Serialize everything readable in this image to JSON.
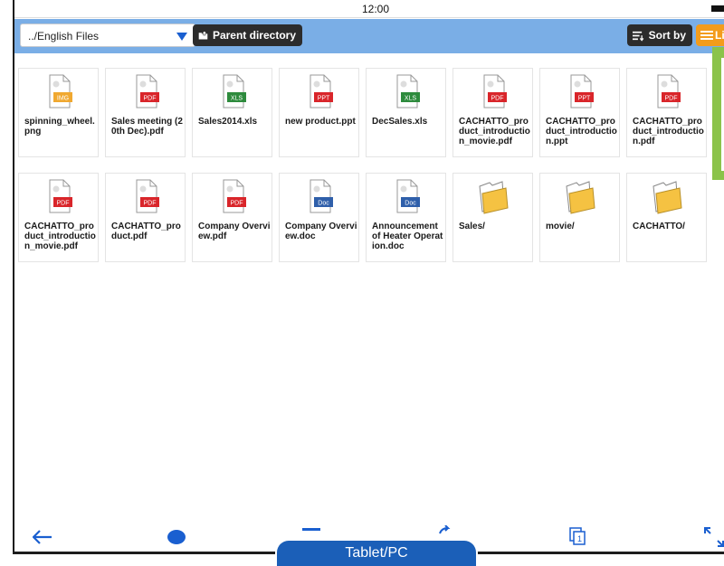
{
  "status_bar": {
    "time": "12:00"
  },
  "toolbar": {
    "path_value": "../English Files",
    "parent_label": "Parent directory",
    "sort_label": "Sort by",
    "list_label": "Li"
  },
  "files": [
    {
      "name": "spinning_wheel.png",
      "type": "IMG",
      "color": "#f0a830"
    },
    {
      "name": "Sales meeting (20th Dec).pdf",
      "type": "PDF",
      "color": "#d9252a"
    },
    {
      "name": "Sales2014.xls",
      "type": "XLS",
      "color": "#2e8b3d"
    },
    {
      "name": "new product.ppt",
      "type": "PPT",
      "color": "#d9252a"
    },
    {
      "name": "DecSales.xls",
      "type": "XLS",
      "color": "#2e8b3d"
    },
    {
      "name": "CACHATTO_product_introduction_movie.pdf",
      "type": "PDF",
      "color": "#d9252a"
    },
    {
      "name": "CACHATTO_product_introduction.ppt",
      "type": "PPT",
      "color": "#d9252a"
    },
    {
      "name": "CACHATTO_product_introduction.pdf",
      "type": "PDF",
      "color": "#d9252a"
    },
    {
      "name": "CACHATTO_product_introduction_movie.pdf",
      "type": "PDF",
      "color": "#d9252a"
    },
    {
      "name": "CACHATTO_product.pdf",
      "type": "PDF",
      "color": "#d9252a"
    },
    {
      "name": "Company Overview.pdf",
      "type": "PDF",
      "color": "#d9252a"
    },
    {
      "name": "Company Overview.doc",
      "type": "Doc",
      "color": "#2f5faa"
    },
    {
      "name": "Announcement of Heater Operation.doc",
      "type": "Doc",
      "color": "#2f5faa"
    },
    {
      "name": "Sales/",
      "type": "folder",
      "color": "#f5c242"
    },
    {
      "name": "movie/",
      "type": "folder",
      "color": "#f5c242"
    },
    {
      "name": "CACHATTO/",
      "type": "folder",
      "color": "#f5c242"
    }
  ],
  "device_label": "Tablet/PC",
  "colors": {
    "accent": "#7aaee6",
    "nav_blue": "#1a5fd0",
    "orange": "#f39c1c",
    "green": "#8bc34a",
    "label_blue": "#1b5fb8"
  },
  "icons": [
    "back-arrow-icon",
    "chat-bubble-icon",
    "minus-icon",
    "share-arrow-icon",
    "page-number-icon",
    "fullscreen-icon"
  ]
}
